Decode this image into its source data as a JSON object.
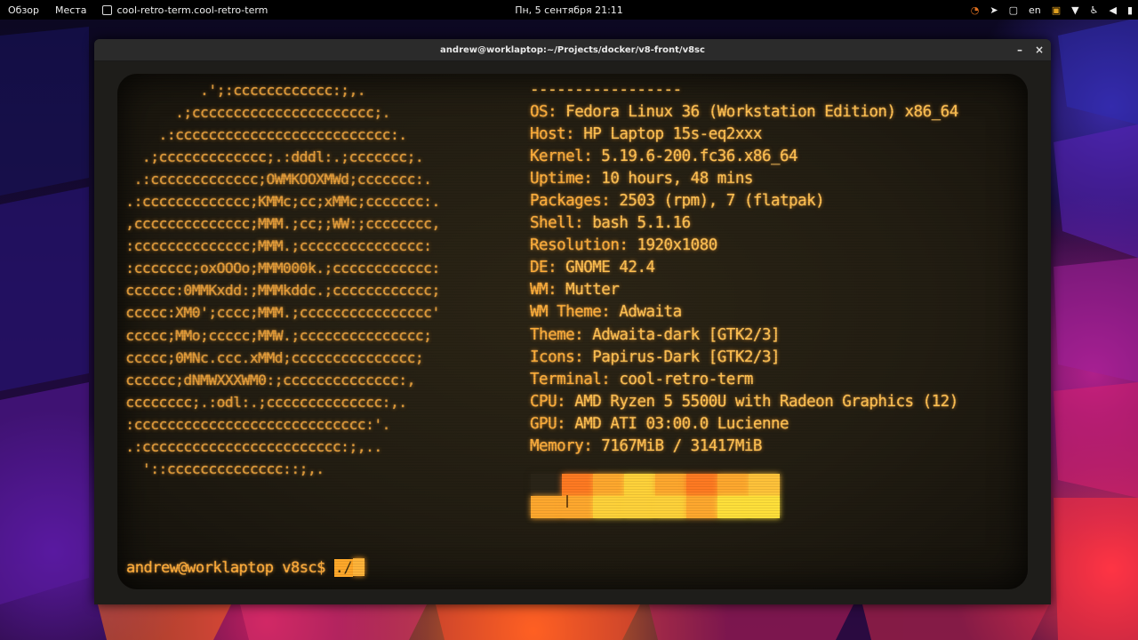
{
  "topbar": {
    "overview": "Обзор",
    "places": "Места",
    "app_title": "cool-retro-term.cool-retro-term",
    "clock": "Пн, 5 сентября  21:11",
    "lang": "en",
    "tray_icons": [
      "timer-icon",
      "telegram-icon",
      "clipboard-icon",
      "language-indicator",
      "notification-icon",
      "wifi-icon",
      "accessibility-icon",
      "volume-icon",
      "battery-icon"
    ]
  },
  "window": {
    "title": "andrew@worklaptop:~/Projects/docker/v8-front/v8sc",
    "minimize": "–",
    "close": "×"
  },
  "terminal": {
    "ascii_art": [
      "          .';:cccccccccccc:;,.",
      "       .;cccccccccccccccccccccc;.",
      "     .:cccccccccccccccccccccccccc:.",
      "   .;ccccccccccccc;.:dddl:.;ccccccc;.",
      "  .:ccccccccccccc;OWMKOOXMWd;ccccccc:.",
      " .:ccccccccccccc;KMMc;cc;xMMc;ccccccc:.",
      " ,cccccccccccccc;MMM.;cc;;WW:;cccccccc,",
      " :cccccccccccccc;MMM.;ccccccccccccccc:",
      " :ccccccc;oxOOOo;MMM000k.;cccccccccccc:",
      " cccccc:0MMKxdd:;MMMkddc.;cccccccccccc;",
      " ccccc:XM0';cccc;MMM.;cccccccccccccccc'",
      " ccccc;MMo;ccccc;MMW.;ccccccccccccccc;",
      " ccccc;0MNc.ccc.xMMd;ccccccccccccccc;",
      " cccccc;dNMWXXXWM0:;cccccccccccccc:,",
      " cccccccc;.:odl:.;cccccccccccccc:,.",
      " :cccccccccccccccccccccccccccc:'.",
      " .:cccccccccccccccccccccccc:;,..",
      "   '::cccccccccccccc::;,."
    ],
    "info": [
      {
        "key": "",
        "val": "-----------------"
      },
      {
        "key": "OS: ",
        "val": "Fedora Linux 36 (Workstation Edition) x86_64"
      },
      {
        "key": "Host: ",
        "val": "HP Laptop 15s-eq2xxx"
      },
      {
        "key": "Kernel: ",
        "val": "5.19.6-200.fc36.x86_64"
      },
      {
        "key": "Uptime: ",
        "val": "10 hours, 48 mins"
      },
      {
        "key": "Packages: ",
        "val": "2503 (rpm), 7 (flatpak)"
      },
      {
        "key": "Shell: ",
        "val": "bash 5.1.16"
      },
      {
        "key": "Resolution: ",
        "val": "1920x1080"
      },
      {
        "key": "DE: ",
        "val": "GNOME 42.4"
      },
      {
        "key": "WM: ",
        "val": "Mutter"
      },
      {
        "key": "WM Theme: ",
        "val": "Adwaita"
      },
      {
        "key": "Theme: ",
        "val": "Adwaita-dark [GTK2/3]"
      },
      {
        "key": "Icons: ",
        "val": "Papirus-Dark [GTK2/3]"
      },
      {
        "key": "Terminal: ",
        "val": "cool-retro-term"
      },
      {
        "key": "CPU: ",
        "val": "AMD Ryzen 5 5500U with Radeon Graphics (12)"
      },
      {
        "key": "GPU: ",
        "val": "AMD ATI 03:00.0 Lucienne"
      },
      {
        "key": "Memory: ",
        "val": "7167MiB / 31417MiB"
      }
    ],
    "palette_top": [
      "#2a2418",
      "#ff7a22",
      "#ffa82e",
      "#ffd23a",
      "#ffa82e",
      "#ff7a22",
      "#ffa82e",
      "#ffc23a"
    ],
    "palette_bottom": [
      "#ffa82e",
      "#ffa82e",
      "#ffd23a",
      "#ffd23a",
      "#ffd23a",
      "#ffa82e",
      "#ffe03a",
      "#ffe03a"
    ],
    "prompt": "andrew@worklaptop v8sc$ ",
    "command": "./"
  }
}
